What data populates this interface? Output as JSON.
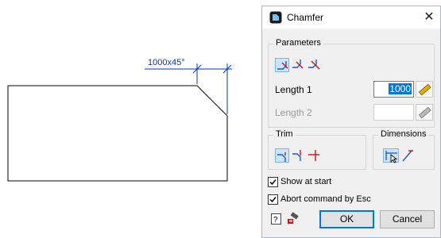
{
  "drawing": {
    "dimension_text": "1000x45°"
  },
  "dialog": {
    "title": "Chamfer",
    "close_glyph": "✕",
    "parameters": {
      "label": "Parameters",
      "length1_label": "Length 1",
      "length1_value": "1000",
      "length2_label": "Length 2",
      "length2_value": ""
    },
    "trim": {
      "label": "Trim"
    },
    "dimensions": {
      "label": "Dimensions"
    },
    "options": {
      "show_at_start": {
        "label": "Show at start",
        "checked": true
      },
      "abort_by_esc": {
        "label": "Abort command by Esc",
        "checked": true
      }
    },
    "buttons": {
      "ok": "OK",
      "cancel": "Cancel"
    }
  }
}
